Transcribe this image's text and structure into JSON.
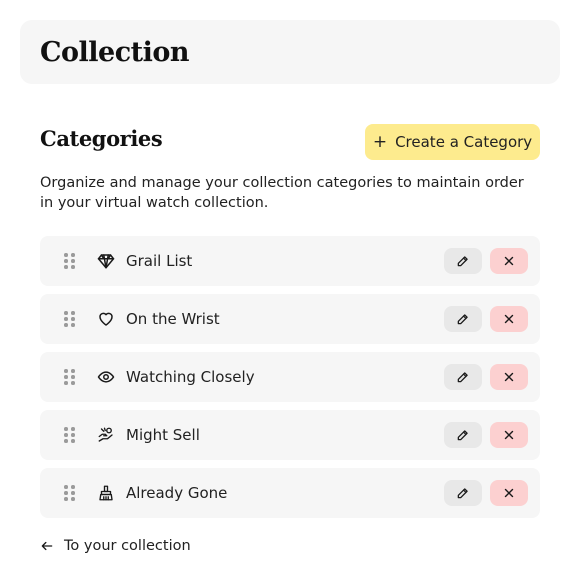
{
  "header": {
    "title": "Collection"
  },
  "categories_section": {
    "title": "Categories",
    "create_button": {
      "icon": "plus-icon",
      "label": "Create a Category"
    },
    "description": "Organize and manage your collection categories to maintain order in your virtual watch collection."
  },
  "categories": [
    {
      "label": "Grail List",
      "icon": "diamond-icon"
    },
    {
      "label": "On the Wrist",
      "icon": "heart-icon"
    },
    {
      "label": "Watching Closely",
      "icon": "eye-icon"
    },
    {
      "label": "Might Sell",
      "icon": "money-hand-icon"
    },
    {
      "label": "Already Gone",
      "icon": "broom-icon"
    }
  ],
  "back_link": {
    "icon": "arrow-left-icon",
    "label": "To your collection"
  },
  "colors": {
    "card_bg": "#f6f6f6",
    "create_button_bg": "#fdeb8e",
    "edit_button_bg": "#e8e8e8",
    "delete_button_bg": "#fcd0d0"
  }
}
